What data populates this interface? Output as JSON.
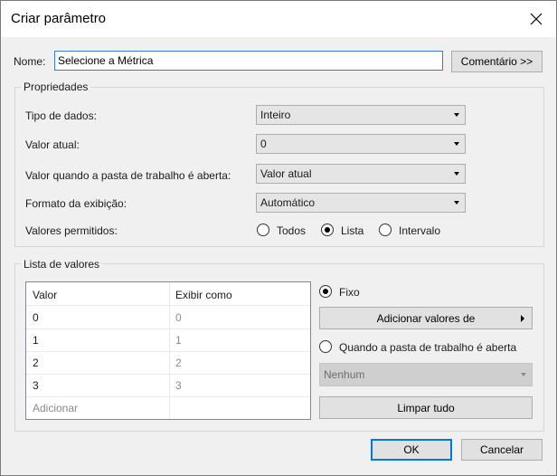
{
  "dialog": {
    "title": "Criar parâmetro",
    "name_label": "Nome:",
    "name_value": "Selecione a Métrica",
    "comment_button": "Comentário >>"
  },
  "properties": {
    "group_label": "Propriedades",
    "data_type_label": "Tipo de dados:",
    "data_type_value": "Inteiro",
    "current_value_label": "Valor atual:",
    "current_value_value": "0",
    "open_value_label": "Valor quando a pasta de trabalho é aberta:",
    "open_value_value": "Valor atual",
    "display_format_label": "Formato da exibição:",
    "display_format_value": "Automático",
    "allowed_values_label": "Valores permitidos:",
    "allowed_options": [
      "Todos",
      "Lista",
      "Intervalo"
    ],
    "allowed_selected": "Lista"
  },
  "value_list": {
    "group_label": "Lista de valores",
    "columns": [
      "Valor",
      "Exibir como"
    ],
    "rows": [
      {
        "value": "0",
        "display": "0"
      },
      {
        "value": "1",
        "display": "1"
      },
      {
        "value": "2",
        "display": "2"
      },
      {
        "value": "3",
        "display": "3"
      }
    ],
    "add_placeholder": "Adicionar",
    "fixed_label": "Fixo",
    "add_values_button": "Adicionar valores de",
    "on_open_label": "Quando a pasta de trabalho é aberta",
    "on_open_select": "Nenhum",
    "clear_button": "Limpar tudo"
  },
  "footer": {
    "ok": "OK",
    "cancel": "Cancelar"
  }
}
